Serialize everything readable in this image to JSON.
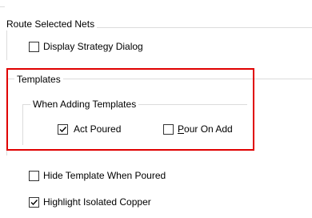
{
  "route_selected_nets": {
    "title": "Route Selected Nets",
    "display_strategy_dialog": {
      "label": "Display Strategy Dialog",
      "checked": false
    }
  },
  "templates": {
    "title": "Templates",
    "when_adding": {
      "title": "When Adding Templates",
      "act_poured": {
        "label": "Act Poured",
        "checked": true
      },
      "pour_on_add": {
        "label_first": "P",
        "label_rest": "our On Add",
        "checked": false
      }
    }
  },
  "hide_template_when_poured": {
    "label": "Hide Template When Poured",
    "checked": false
  },
  "highlight_isolated_copper": {
    "label": "Highlight Isolated Copper",
    "checked": true
  },
  "colors": {
    "highlight_border": "#e00000",
    "frame": "#dcdcdc"
  }
}
